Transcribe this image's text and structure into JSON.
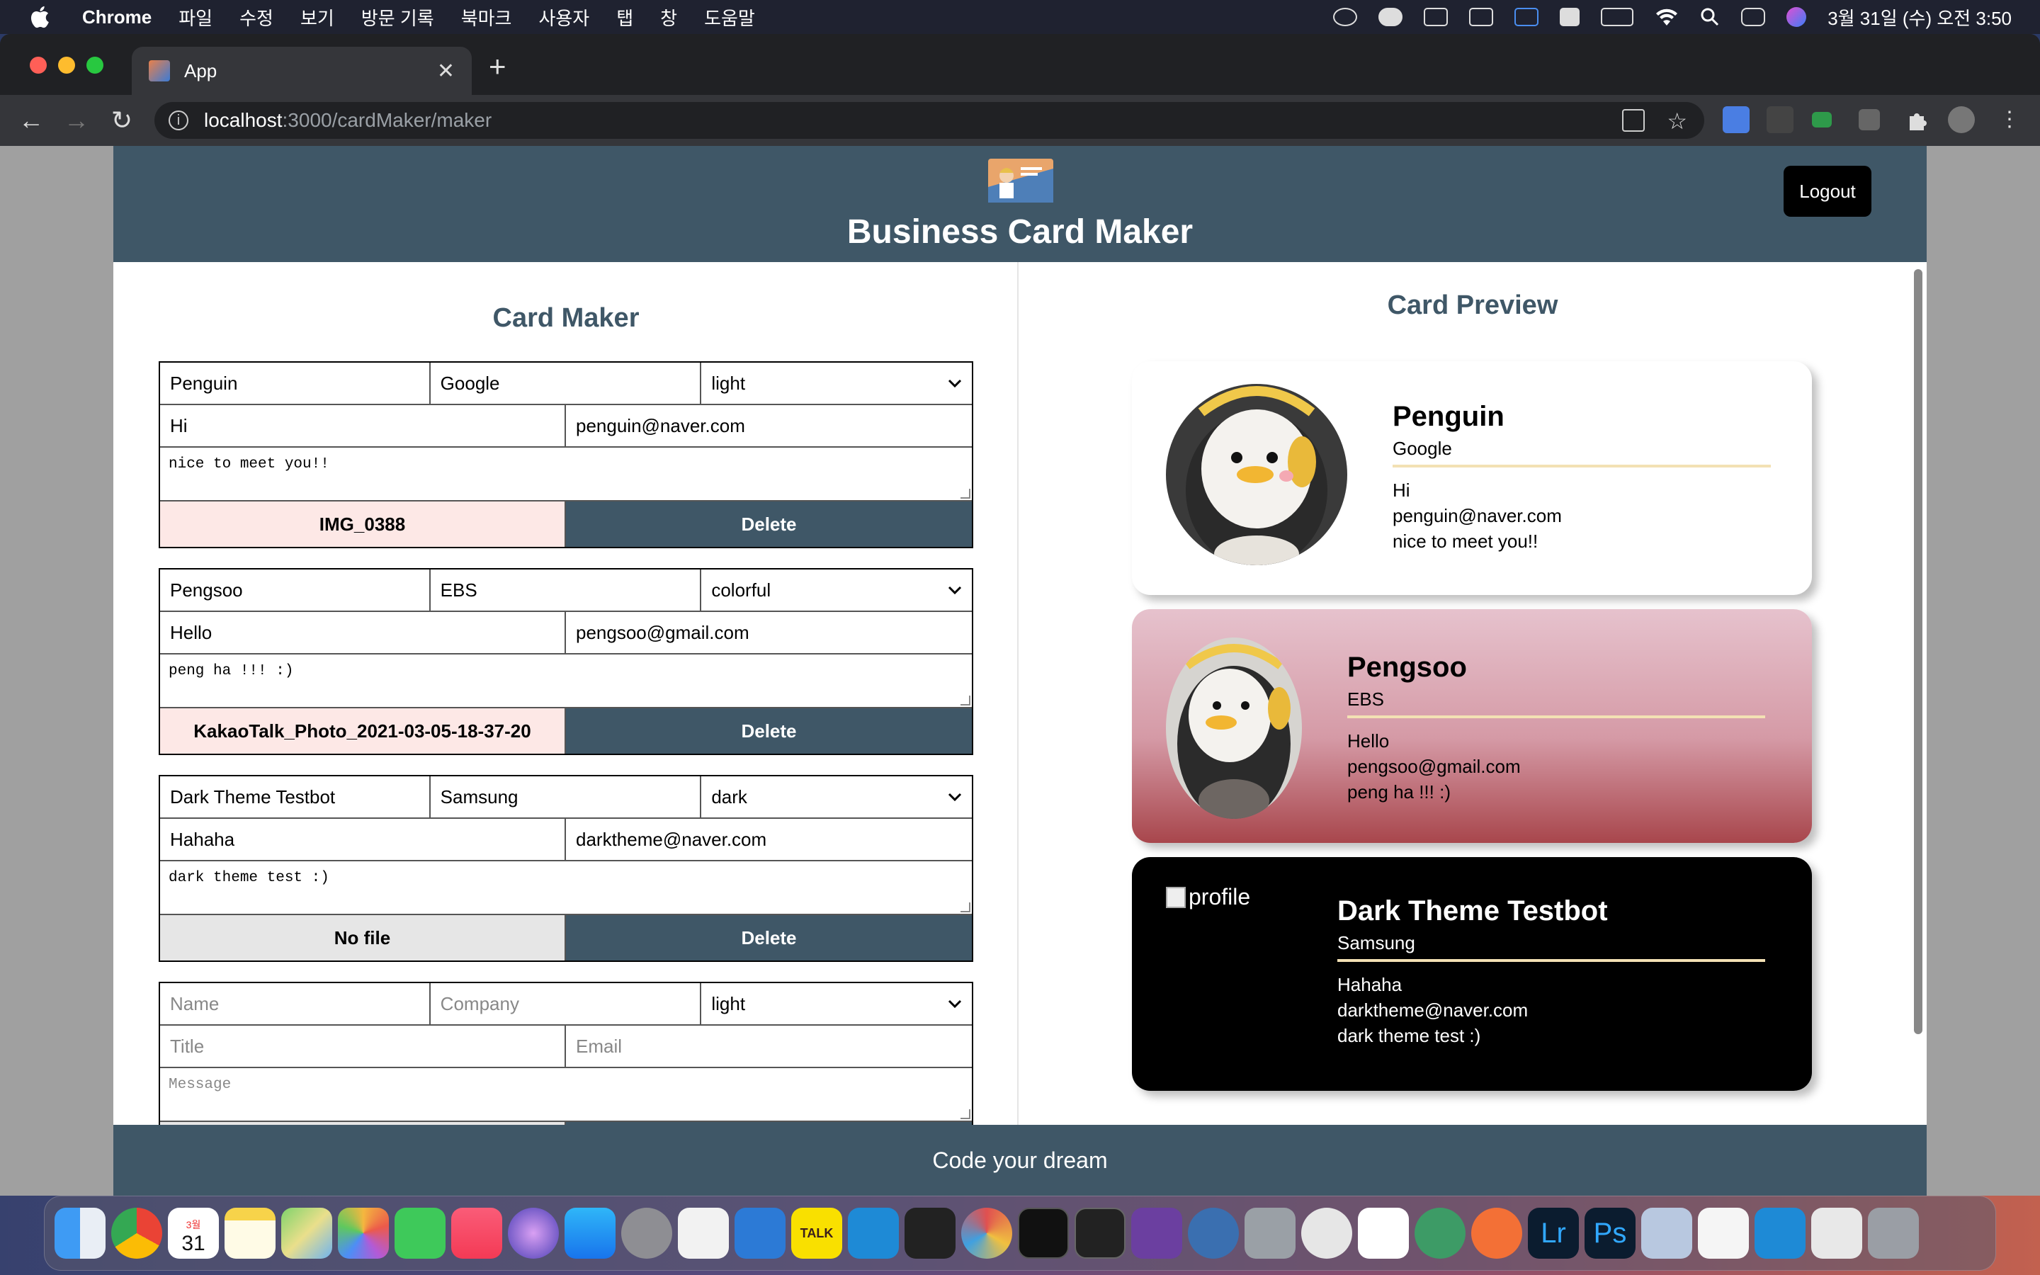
{
  "menubar": {
    "app": "Chrome",
    "items": [
      "파일",
      "수정",
      "보기",
      "방문 기록",
      "북마크",
      "사용자",
      "탭",
      "창",
      "도움말"
    ],
    "clock": "3월 31일 (수) 오전 3:50"
  },
  "browser": {
    "tab_title": "App",
    "url_host": "localhost",
    "url_rest": ":3000/cardMaker/maker"
  },
  "header": {
    "title": "Business Card Maker",
    "logout_label": "Logout"
  },
  "maker": {
    "title": "Card Maker",
    "delete_label": "Delete",
    "cards": [
      {
        "name": "Penguin",
        "company": "Google",
        "theme": "light",
        "title": "Hi",
        "email": "penguin@naver.com",
        "message": "nice to meet you!!",
        "file": "IMG_0388"
      },
      {
        "name": "Pengsoo",
        "company": "EBS",
        "theme": "colorful",
        "title": "Hello",
        "email": "pengsoo@gmail.com",
        "message": "peng ha !!! :)",
        "file": "KakaoTalk_Photo_2021-03-05-18-37-20"
      },
      {
        "name": "Dark Theme Testbot",
        "company": "Samsung",
        "theme": "dark",
        "title": "Hahaha",
        "email": "darktheme@naver.com",
        "message": "dark theme test :)",
        "file": "No file"
      }
    ],
    "add_form": {
      "name_placeholder": "Name",
      "company_placeholder": "Company",
      "theme": "light",
      "title_placeholder": "Title",
      "email_placeholder": "Email",
      "message_placeholder": "Message"
    }
  },
  "preview": {
    "title": "Card Preview",
    "broken_alt": "profile",
    "cards": [
      {
        "name": "Penguin",
        "company": "Google",
        "title": "Hi",
        "email": "penguin@naver.com",
        "message": "nice to meet you!!"
      },
      {
        "name": "Pengsoo",
        "company": "EBS",
        "title": "Hello",
        "email": "pengsoo@gmail.com",
        "message": "peng ha !!! :)"
      },
      {
        "name": "Dark Theme Testbot",
        "company": "Samsung",
        "title": "Hahaha",
        "email": "darktheme@naver.com",
        "message": "dark theme test :)"
      }
    ]
  },
  "footer": {
    "text": "Code your dream"
  },
  "colors": {
    "brand": "#3f5767",
    "file_button": "#fde8e6",
    "accent_line": "#f3e1b4"
  },
  "dock": {
    "calendar_day": "31",
    "calendar_month": "3월",
    "lr_label": "Lr",
    "ps_label": "Ps",
    "kakao_label": "TALK"
  }
}
